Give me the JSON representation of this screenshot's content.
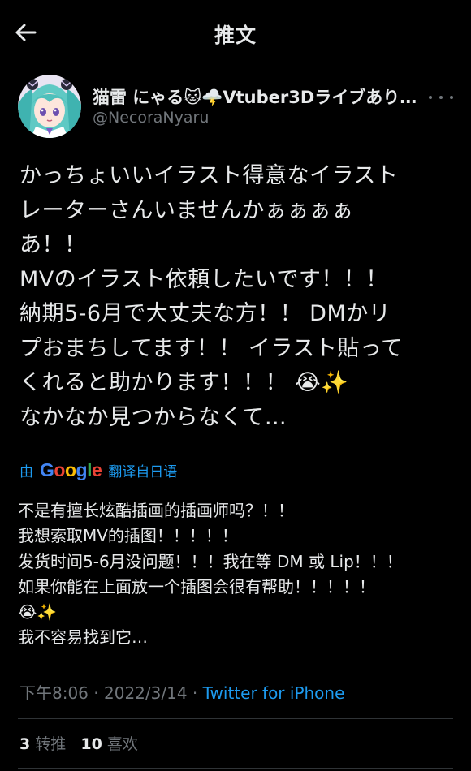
{
  "header": {
    "title": "推文",
    "back_icon": "arrow-left-icon"
  },
  "author": {
    "display_name": "猫雷 にゃる",
    "name_emoji_1": "🐱",
    "name_emoji_2": "🌩️",
    "name_suffix": "Vtuber3Dライブあり…",
    "handle": "@NecoraNyaru",
    "more_icon": "more-horizontal-icon"
  },
  "tweet": {
    "lines": [
      "かっちょいいイラスト得意なイラスト",
      "レーターさんいませんかぁぁぁぁ",
      "あ！！",
      "MVのイラスト依頼したいです！！！",
      "納期5-6月で大丈夫な方！！ DMかリ",
      "プおまちしてます！！ イラスト貼って",
      "くれると助かります！！！ 😭✨",
      "なかなか見つからなくて…"
    ]
  },
  "translation": {
    "prefix": "由",
    "provider": "Google",
    "suffix": "翻译自日语",
    "lines": [
      "不是有擅长炫酷插画的插画师吗？！！",
      "我想索取MV的插图！！！！！",
      "发货时间5-6月没问题！！！我在等 DM 或 Lip！！！",
      "如果你能在上面放一个插图会很有帮助！！！！！",
      "😭✨",
      "我不容易找到它…"
    ]
  },
  "meta": {
    "time": "下午8:06",
    "separator_1": "·",
    "date": "2022/3/14",
    "separator_2": "·",
    "source": "Twitter for iPhone"
  },
  "stats": {
    "retweets_count": "3",
    "retweets_label": "转推",
    "likes_count": "10",
    "likes_label": "喜欢"
  },
  "colors": {
    "background": "#000000",
    "text": "#e7e9ea",
    "secondary_text": "#71767b",
    "accent": "#1d9bf0",
    "divider": "#2f3336"
  }
}
